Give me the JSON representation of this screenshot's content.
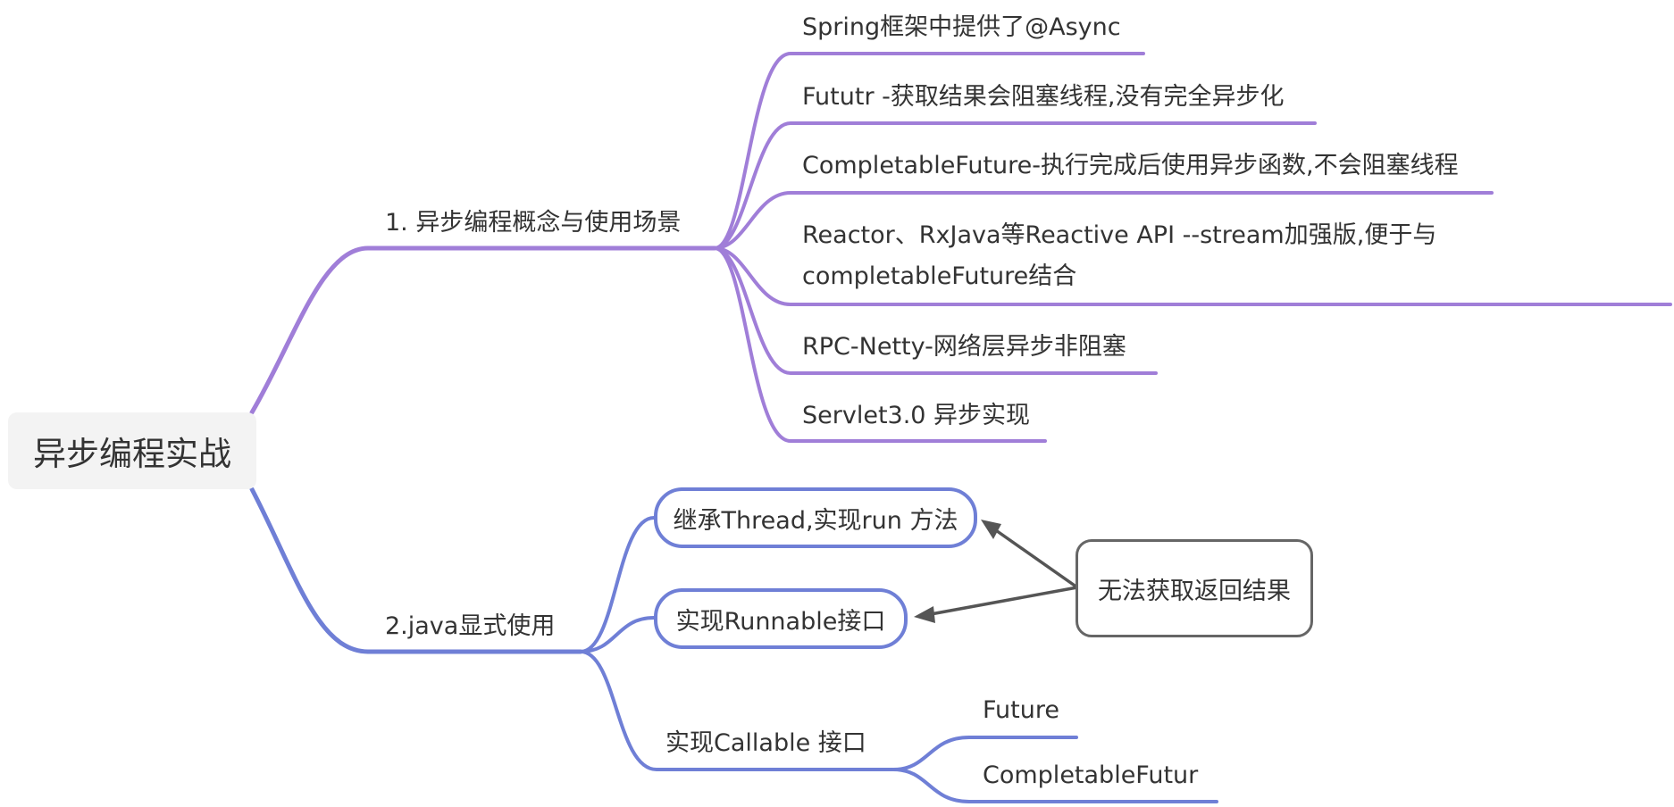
{
  "root": {
    "label": "异步编程实战"
  },
  "branch1": {
    "label": "1. 异步编程概念与使用场景",
    "color": "#a07ed8",
    "items": [
      {
        "label": "Spring框架中提供了@Async"
      },
      {
        "label": "Fututr -获取结果会阻塞线程,没有完全异步化"
      },
      {
        "label": "CompletableFuture-执行完成后使用异步函数,不会阻塞线程"
      },
      {
        "label": "Reactor、RxJava等Reactive API --stream加强版,便于与 completableFuture结合"
      },
      {
        "label": "RPC-Netty-网络层异步非阻塞"
      },
      {
        "label": "Servlet3.0 异步实现"
      }
    ]
  },
  "branch2": {
    "label": "2.java显式使用",
    "color": "#6f7fd6",
    "items": [
      {
        "label": "继承Thread,实现run 方法"
      },
      {
        "label": "实现Runnable接口"
      },
      {
        "label": "实现Callable 接口",
        "children": [
          {
            "label": "Future"
          },
          {
            "label": "CompletableFutur"
          }
        ]
      }
    ]
  },
  "callout": {
    "label": "无法获取返回结果",
    "border_color": "#666666"
  }
}
